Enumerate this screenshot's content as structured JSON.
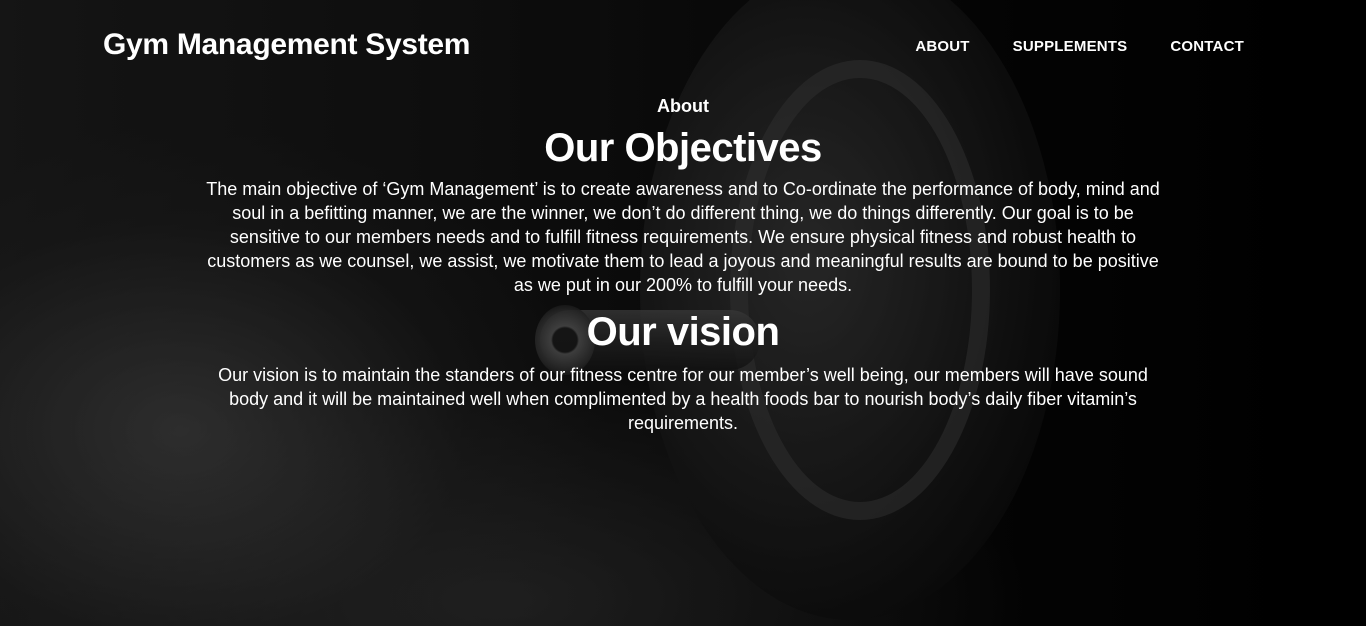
{
  "header": {
    "brand": "Gym Management System",
    "nav": [
      {
        "label": "ABOUT"
      },
      {
        "label": "SUPPLEMENTS"
      },
      {
        "label": "CONTACT"
      }
    ]
  },
  "main": {
    "section_label": "About",
    "objectives": {
      "title": "Our Objectives",
      "text": "The main objective of ‘Gym Management’ is to create awareness and to Co-ordinate the performance of body, mind and soul in a befitting manner, we are the winner, we don’t do different thing, we do things differently. Our goal is to be sensitive to our members needs and to fulfill fitness requirements. We ensure physical fitness and robust health to customers as we counsel, we assist, we motivate them to lead a joyous and meaningful results are bound to be positive as we put in our 200% to fulfill your needs."
    },
    "vision": {
      "title": "Our vision",
      "text": "Our vision is to maintain the standers of our fitness centre for our member’s well being, our members will have sound body and it will be maintained well when complimented by a health foods bar to nourish body’s daily fiber vitamin’s requirements."
    }
  },
  "colors": {
    "text": "#ffffff",
    "background": "#000000"
  }
}
